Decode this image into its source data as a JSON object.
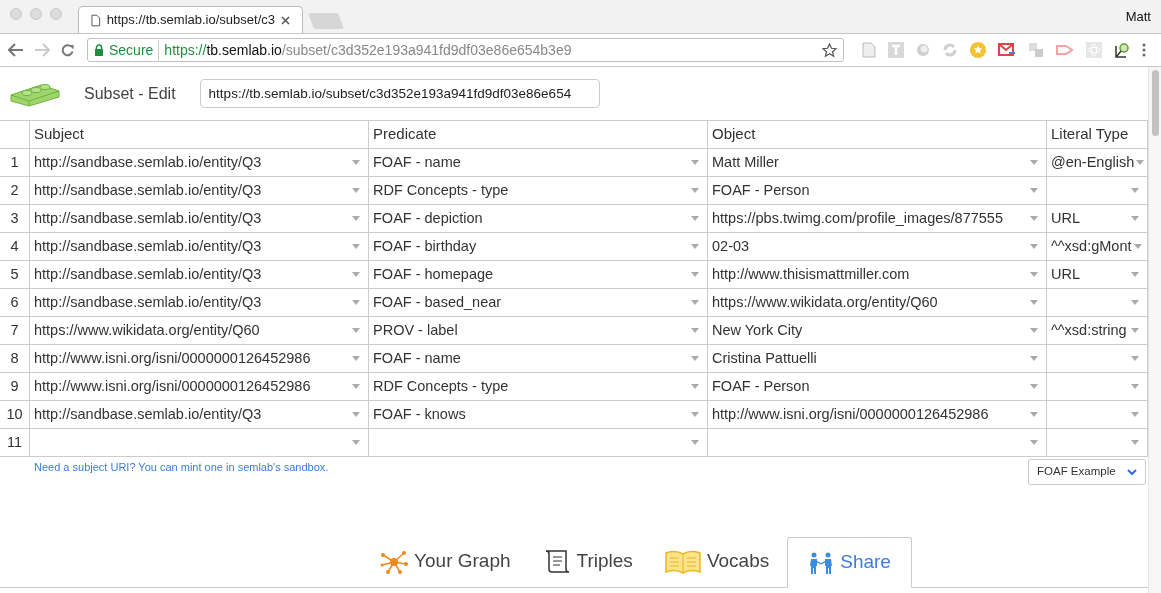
{
  "browser": {
    "tab_title": "https://tb.semlab.io/subset/c3",
    "profile": "Matt",
    "secure_label": "Secure",
    "url_scheme": "https://",
    "url_host": "tb.semlab.io",
    "url_path": "/subset/c3d352e193a941fd9df03e86e654b3e9"
  },
  "header": {
    "title": "Subset - Edit",
    "url_value": "https://tb.semlab.io/subset/c3d352e193a941fd9df03e86e654"
  },
  "table": {
    "columns": [
      "Subject",
      "Predicate",
      "Object",
      "Literal Type"
    ],
    "rows": [
      {
        "number": "1",
        "subject": "http://sandbase.semlab.io/entity/Q3",
        "predicate": "FOAF - name",
        "object": "Matt Miller",
        "literal_type": "@en-English"
      },
      {
        "number": "2",
        "subject": "http://sandbase.semlab.io/entity/Q3",
        "predicate": "RDF Concepts - type",
        "object": "FOAF - Person"
      },
      {
        "number": "3",
        "subject": "http://sandbase.semlab.io/entity/Q3",
        "predicate": "FOAF - depiction",
        "object": "https://pbs.twimg.com/profile_images/877555",
        "literal_type": "URL"
      },
      {
        "number": "4",
        "subject": "http://sandbase.semlab.io/entity/Q3",
        "predicate": "FOAF - birthday",
        "object": "02-03",
        "literal_type": "^^xsd:gMont"
      },
      {
        "number": "5",
        "subject": "http://sandbase.semlab.io/entity/Q3",
        "predicate": "FOAF - homepage",
        "object": "http://www.thisismattmiller.com",
        "literal_type": "URL"
      },
      {
        "number": "6",
        "subject": "http://sandbase.semlab.io/entity/Q3",
        "predicate": "FOAF - based_near",
        "object": "https://www.wikidata.org/entity/Q60"
      },
      {
        "number": "7",
        "subject": "https://www.wikidata.org/entity/Q60",
        "predicate": "PROV - label",
        "object": "New York City",
        "literal_type": "^^xsd:string"
      },
      {
        "number": "8",
        "subject": "http://www.isni.org/isni/0000000126452986",
        "predicate": "FOAF - name",
        "object": "Cristina Pattuelli"
      },
      {
        "number": "9",
        "subject": "http://www.isni.org/isni/0000000126452986",
        "predicate": "RDF Concepts - type",
        "object": "FOAF - Person"
      },
      {
        "number": "10",
        "subject": "http://sandbase.semlab.io/entity/Q3",
        "predicate": "FOAF - knows",
        "object": "http://www.isni.org/isni/0000000126452986"
      },
      {
        "number": "11"
      }
    ]
  },
  "hint": "Need a subject URI? You can mint one in semlab's sandbox.",
  "example_select": "FOAF Example",
  "bottom_tabs": [
    {
      "label": "Your Graph",
      "kind": "graph",
      "selected": false
    },
    {
      "label": "Triples",
      "kind": "triples",
      "selected": false
    },
    {
      "label": "Vocabs",
      "kind": "vocabs",
      "selected": false
    },
    {
      "label": "Share",
      "kind": "share",
      "selected": true
    }
  ]
}
